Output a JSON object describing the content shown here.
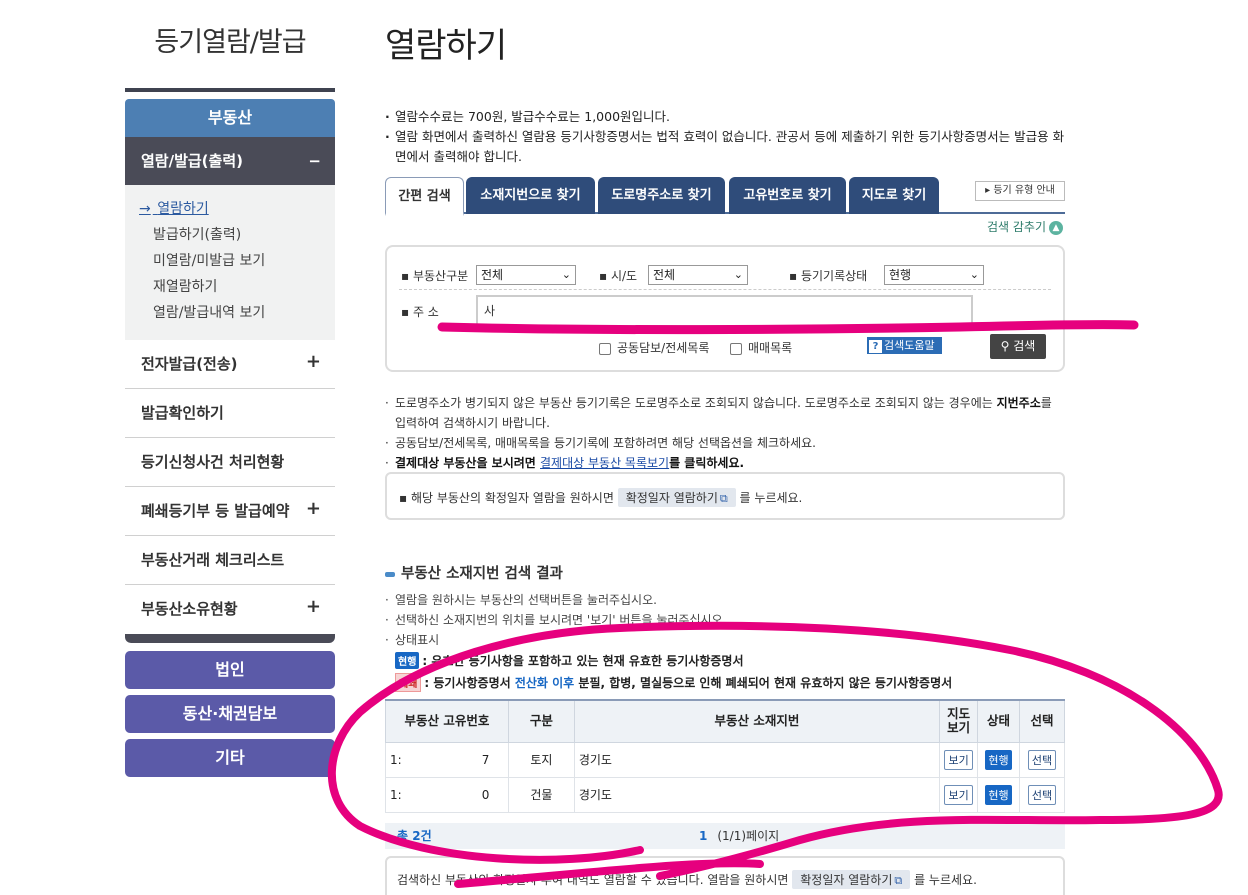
{
  "sidebar": {
    "title": "등기열람/발급",
    "section_header": "부동산",
    "active_menu": "열람/발급(출력)",
    "active_toggle": "−",
    "sub_items": [
      "열람하기",
      "발급하기(출력)",
      "미열람/미발급 보기",
      "재열람하기",
      "열람/발급내역 보기"
    ],
    "current_marker": "→",
    "menu": [
      {
        "label": "전자발급(전송)",
        "toggle": "+"
      },
      {
        "label": "발급확인하기",
        "toggle": ""
      },
      {
        "label": "등기신청사건 처리현황",
        "toggle": ""
      },
      {
        "label": "폐쇄등기부 등 발급예약",
        "toggle": "+"
      },
      {
        "label": "부동산거래 체크리스트",
        "toggle": ""
      },
      {
        "label": "부동산소유현황",
        "toggle": "+"
      }
    ],
    "buttons": [
      "법인",
      "동산·채권담보",
      "기타"
    ]
  },
  "main": {
    "title": "열람하기",
    "notices": [
      "열람수수료는 700원, 발급수수료는 1,000원입니다.",
      "열람 화면에서 출력하신 열람용 등기사항증명서는 법적 효력이 없습니다. 관공서 등에 제출하기 위한 등기사항증명서는 발급용 화면에서 출력해야 합니다."
    ],
    "tabs": [
      "간편 검색",
      "소재지번으로 찾기",
      "도로명주소로 찾기",
      "고유번호로 찾기",
      "지도로 찾기"
    ],
    "type_guide": "등기 유형 안내",
    "hide_search": "검색 감추기",
    "form": {
      "property_type_label": "부동산구분",
      "property_type_value": "전체",
      "sido_label": "시/도",
      "sido_value": "전체",
      "status_label": "등기기록상태",
      "status_value": "현행",
      "address_label": "주 소",
      "address_value": "사",
      "option_joint": "공동담보/전세목록",
      "option_sale": "매매목록",
      "help_label": "검색도움말",
      "search_label": "검색"
    },
    "info": {
      "line1": "도로명주소가 병기되지 않은 부동산 등기기록은 도로명주소로 조회되지 않습니다. 도로명주소로 조회되지 않는 경우에는 ",
      "line1_bold": "지번주소",
      "line1_end": "를 입력하여 검색하시기 바랍니다.",
      "line2": "공동담보/전세목록, 매매목록을 등기기록에 포함하려면 해당 선택옵션을 체크하세요.",
      "line3_a": "결제대상 부동산을 보시려면 ",
      "line3_link": "결제대상 부동산 목록보기",
      "line3_b": "를 클릭하세요."
    },
    "confirm": {
      "before": "해당 부동산의 확정일자 열람을 원하시면 ",
      "button": "확정일자 열람하기",
      "after": " 를 누르세요."
    },
    "results": {
      "title": "부동산 소재지번 검색 결과",
      "notes": [
        "열람을 원하시는 부동산의 선택버튼을 눌러주십시오.",
        "선택하신 소재지번의 위치를 보시려면 '보기' 버튼을 눌러주십시오.",
        "상태표시"
      ],
      "legend_current_badge": "현행",
      "legend_current_text": ": 유효한 등기사항을 포함하고 있는 현재 유효한 등기사항증명서",
      "legend_closed_badge": "폐쇄",
      "legend_closed_a": ": 등기사항증명서 ",
      "legend_closed_em": "전산화 이후",
      "legend_closed_b": " 분필, 합병, 멸실등으로 인해 폐쇄되어 현재 유효하지 않은 등기사항증명서",
      "columns": [
        "부동산 고유번호",
        "구분",
        "부동산 소재지번",
        "지도 보기",
        "상태",
        "선택"
      ],
      "rows": [
        {
          "id_start": "1:",
          "id_end": "7",
          "type": "토지",
          "address": "경기도",
          "map": "보기",
          "status": "현행",
          "select": "선택"
        },
        {
          "id_start": "1:",
          "id_end": "0",
          "type": "건물",
          "address": "경기도",
          "map": "보기",
          "status": "현행",
          "select": "선택"
        }
      ],
      "total": "총 2건",
      "page_current": "1",
      "page_info": "(1/1)페이지"
    },
    "bottom": {
      "before": "검색하신 부동산의 확정일자 부여 내역도 열람할 수 있습니다. 열람을 원하시면 ",
      "button": "확정일자 열람하기",
      "after": " 를 누르세요."
    }
  },
  "colors": {
    "accent_blue": "#4d7fb3",
    "tab_navy": "#2f4c7a",
    "menu_purple": "#5b5aa8",
    "status_blue": "#1767c4",
    "annotation_magenta": "#e6007e"
  }
}
